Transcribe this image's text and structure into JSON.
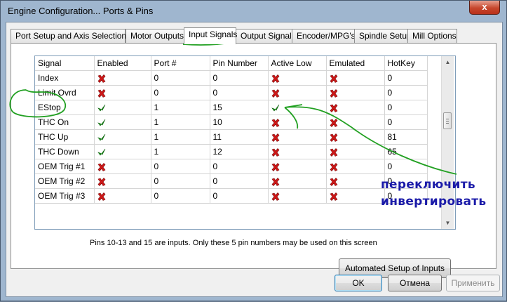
{
  "window": {
    "title": "Engine Configuration... Ports & Pins",
    "close_glyph": "x"
  },
  "tabs": [
    {
      "label": "Port Setup and Axis Selection",
      "active": false
    },
    {
      "label": "Motor Outputs",
      "active": false
    },
    {
      "label": "Input Signals",
      "active": true
    },
    {
      "label": "Output Signals",
      "active": false
    },
    {
      "label": "Encoder/MPG's",
      "active": false
    },
    {
      "label": "Spindle Setup",
      "active": false
    },
    {
      "label": "Mill Options",
      "active": false
    }
  ],
  "table": {
    "columns": [
      "Signal",
      "Enabled",
      "Port #",
      "Pin Number",
      "Active Low",
      "Emulated",
      "HotKey"
    ],
    "rows": [
      {
        "signal": "Index",
        "enabled": false,
        "port": "0",
        "pin": "0",
        "active_low": false,
        "emulated": false,
        "hotkey": "0"
      },
      {
        "signal": "Limit Ovrd",
        "enabled": false,
        "port": "0",
        "pin": "0",
        "active_low": false,
        "emulated": false,
        "hotkey": "0"
      },
      {
        "signal": "EStop",
        "enabled": true,
        "port": "1",
        "pin": "15",
        "active_low": true,
        "emulated": false,
        "hotkey": "0"
      },
      {
        "signal": "THC On",
        "enabled": true,
        "port": "1",
        "pin": "10",
        "active_low": false,
        "emulated": false,
        "hotkey": "0"
      },
      {
        "signal": "THC Up",
        "enabled": true,
        "port": "1",
        "pin": "11",
        "active_low": false,
        "emulated": false,
        "hotkey": "81"
      },
      {
        "signal": "THC Down",
        "enabled": true,
        "port": "1",
        "pin": "12",
        "active_low": false,
        "emulated": false,
        "hotkey": "65"
      },
      {
        "signal": "OEM Trig #1",
        "enabled": false,
        "port": "0",
        "pin": "0",
        "active_low": false,
        "emulated": false,
        "hotkey": "0"
      },
      {
        "signal": "OEM Trig #2",
        "enabled": false,
        "port": "0",
        "pin": "0",
        "active_low": false,
        "emulated": false,
        "hotkey": "0"
      },
      {
        "signal": "OEM Trig #3",
        "enabled": false,
        "port": "0",
        "pin": "0",
        "active_low": false,
        "emulated": false,
        "hotkey": "0"
      }
    ]
  },
  "info_text": "Pins 10-13 and 15 are inputs. Only these 5 pin numbers may be used on this screen",
  "buttons": {
    "auto_setup": "Automated Setup of Inputs",
    "ok": "OK",
    "cancel": "Отмена",
    "apply": "Применить"
  },
  "annotation": {
    "line1": "переключить",
    "line2": "инвертировать",
    "color": "#1a1aa8",
    "marker_color": "#22a022"
  },
  "icons": {
    "enabled_true": "green-check-icon",
    "enabled_false": "red-x-icon"
  }
}
